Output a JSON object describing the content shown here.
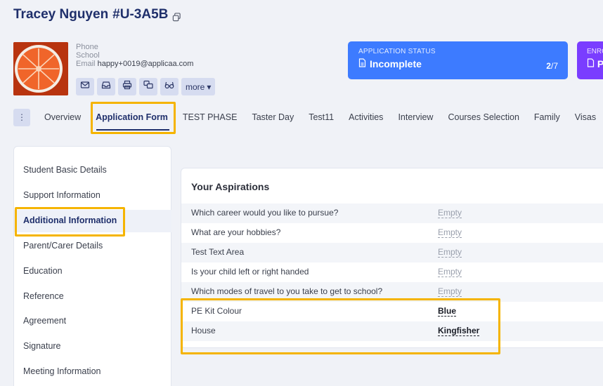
{
  "applicant": {
    "name": "Tracey Nguyen",
    "id": "#U-3A5B"
  },
  "contact": {
    "phone_label": "Phone",
    "school_label": "School",
    "email_label": "Email",
    "email_value": "happy+0019@applicaa.com"
  },
  "actions": {
    "icons": [
      "mail-icon",
      "inbox-icon",
      "print-icon",
      "chat-icon",
      "glasses-icon"
    ],
    "more_label": "more"
  },
  "status": {
    "label": "APPLICATION STATUS",
    "value": "Incomplete",
    "count_current": "2",
    "count_total": "/7",
    "label2": "ENRO",
    "value2": "P"
  },
  "tabs": [
    "Overview",
    "Application Form",
    "TEST PHASE",
    "Taster Day",
    "Test11",
    "Activities",
    "Interview",
    "Courses Selection",
    "Family",
    "Visas"
  ],
  "active_tab": "Application Form",
  "sidenav": [
    "Student Basic Details",
    "Support Information",
    "Additional Information",
    "Parent/Carer Details",
    "Education",
    "Reference",
    "Agreement",
    "Signature",
    "Meeting Information"
  ],
  "active_section": "Additional Information",
  "panel": {
    "title": "Your Aspirations",
    "rows": [
      {
        "question": "Which career would you like to pursue?",
        "answer": "Empty"
      },
      {
        "question": "What are your hobbies?",
        "answer": "Empty"
      },
      {
        "question": "Test Text Area",
        "answer": "Empty"
      },
      {
        "question": "Is your child left or right handed",
        "answer": "Empty"
      },
      {
        "question": "Which modes of travel to you take to get to school?",
        "answer": "Empty"
      },
      {
        "question": "PE Kit Colour",
        "answer": "Blue"
      },
      {
        "question": "House",
        "answer": "Kingfisher"
      }
    ]
  },
  "colors": {
    "accent": "#3d7bff",
    "highlight": "#f5b400",
    "title": "#1f2f6b"
  }
}
